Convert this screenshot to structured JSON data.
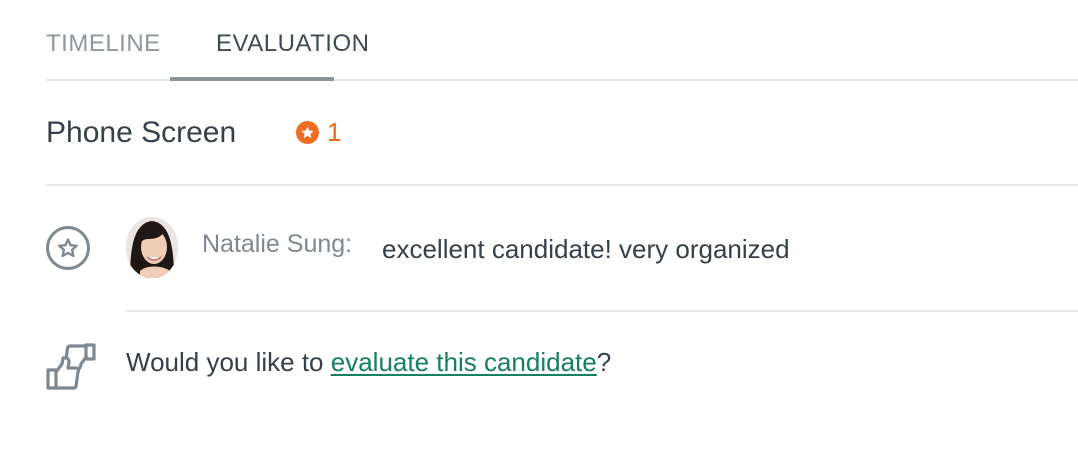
{
  "tabs": [
    {
      "label": "TIMELINE",
      "active": false
    },
    {
      "label": "EVALUATION",
      "active": true
    }
  ],
  "section": {
    "title": "Phone Screen",
    "badge_count": "1",
    "badge_icon": "star-icon",
    "badge_color": "#ef6d22"
  },
  "evaluation": {
    "icon": "star-icon",
    "author": "Natalie Sung:",
    "comment": "excellent candidate! very organized"
  },
  "prompt": {
    "icon": "thumbs-up-down-icon",
    "before": "Would you like to ",
    "link": "evaluate this candidate",
    "after": "?",
    "link_color": "#138062"
  }
}
